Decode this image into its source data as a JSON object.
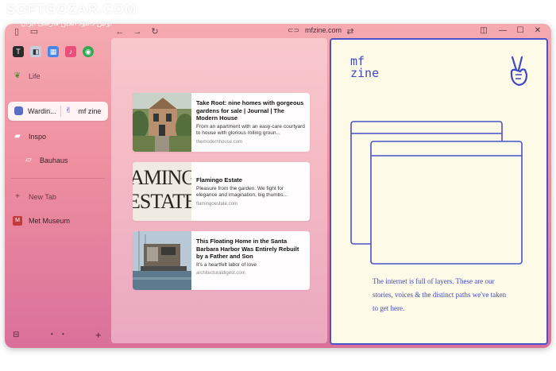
{
  "browser": {
    "url": "mfzine.com",
    "accent_color": "#4a53c8",
    "frame_gradient": [
      "#f5aab0",
      "#d9709a"
    ]
  },
  "watermark": {
    "title": "SOFTGOZAR.COM",
    "subtitle": "اولین دانلود آنلاین فارسی ایران"
  },
  "sidebar": {
    "section_label": "Life",
    "split_tab": {
      "left": "Wardin...",
      "right": "mf zine"
    },
    "items": [
      {
        "label": "Inspo",
        "icon": "folder-icon"
      },
      {
        "label": "Bauhaus",
        "icon": "folder-icon"
      },
      {
        "label": "New Tab",
        "icon": "plus-icon"
      },
      {
        "label": "Met Museum",
        "icon": "met-icon"
      }
    ]
  },
  "cards": [
    {
      "title": "Take Root: nine homes with gorgeous gardens for sale | Journal | The Modern House",
      "desc": "From an apartment with an easy-care courtyard to house with glorious rolling groun...",
      "domain": "themodernhouse.com"
    },
    {
      "title": "Flamingo Estate",
      "desc": "Pleasure from the garden. We fight for elegance and imagination, big thumbs...",
      "domain": "flamingoestate.com",
      "thumb_text": [
        "AMINGO",
        "ESTATE"
      ]
    },
    {
      "title": "This Floating Home in the Santa Barbara Harbor Was Entirely Rebuilt by a Father and Son",
      "desc": "It's a heartfelt labor of love",
      "domain": "architecturaldigest.com"
    }
  ],
  "zine": {
    "logo_line1": "mf",
    "logo_line2": "zine",
    "tagline": "The internet is full of layers. These are our stories, voices & the distinct paths we've taken to get here."
  }
}
